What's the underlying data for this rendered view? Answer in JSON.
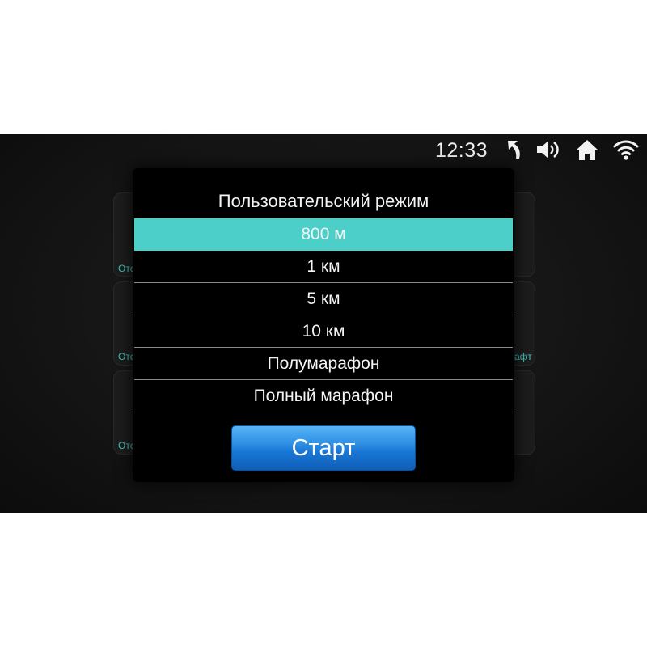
{
  "status_bar": {
    "time": "12:33",
    "icons": [
      "back-icon",
      "volume-icon",
      "home-icon",
      "wifi-icon"
    ]
  },
  "background_tiles": {
    "left_labels": [
      "Отс",
      "Отс",
      "Отс"
    ],
    "right_labels": [
      "афт"
    ]
  },
  "dialog": {
    "title": "Пользовательский режим",
    "options": [
      "800 м",
      "1 км",
      "5 км",
      "10 км",
      "Полумарафон",
      "Полный марафон"
    ],
    "selected_option": "800 м",
    "start_label": "Старт"
  },
  "colors": {
    "accent": "#4ccfc9",
    "button": "#1f7fd8",
    "dialog_bg": "#000000",
    "screen_bg": "#161616"
  }
}
